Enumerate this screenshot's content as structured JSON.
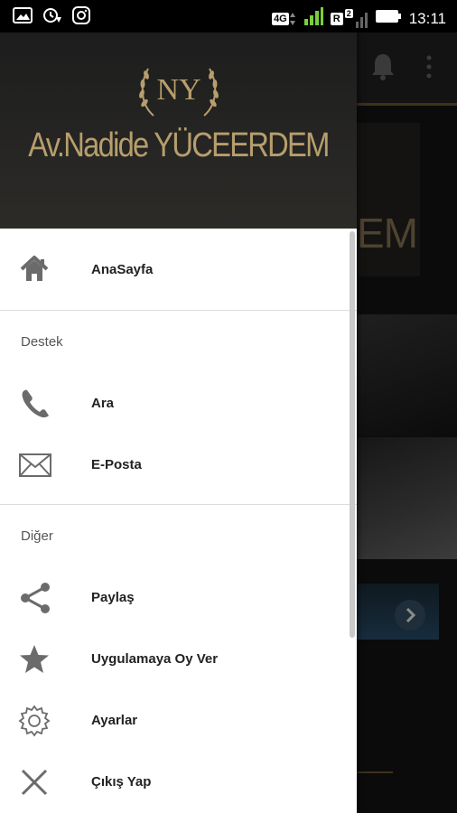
{
  "status_bar": {
    "time": "13:11",
    "network": "4G",
    "sim_badge": "R",
    "sim_number": "2",
    "left_icons": [
      "image-icon",
      "sync-icon",
      "instagram-icon"
    ]
  },
  "drawer": {
    "logo_text": "NY",
    "brand": "Av.Nadide YÜCEERDEM",
    "home": {
      "label": "AnaSayfa",
      "icon": "home-icon"
    },
    "sections": [
      {
        "title": "Destek",
        "items": [
          {
            "label": "Ara",
            "icon": "phone-icon"
          },
          {
            "label": "E-Posta",
            "icon": "mail-icon"
          }
        ]
      },
      {
        "title": "Diğer",
        "items": [
          {
            "label": "Paylaş",
            "icon": "share-icon"
          },
          {
            "label": "Uygulamaya Oy Ver",
            "icon": "star-icon"
          },
          {
            "label": "Ayarlar",
            "icon": "gear-icon"
          },
          {
            "label": "Çıkış Yap",
            "icon": "close-icon"
          }
        ]
      }
    ]
  },
  "background": {
    "banner_text": "EM"
  },
  "colors": {
    "gold": "#b79e6c",
    "header_bg": "#1d1d1d",
    "icon_gray": "#6b6b6b"
  }
}
